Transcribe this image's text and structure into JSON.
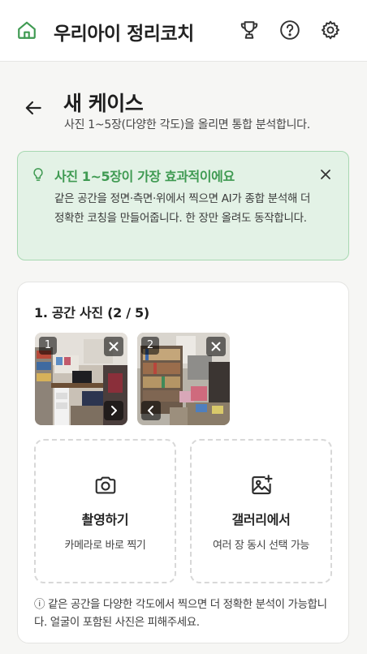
{
  "header": {
    "title": "우리아이 정리코치",
    "icons": [
      "home-icon",
      "trophy-icon",
      "help-icon",
      "gear-icon"
    ],
    "accent": "#3f9a52"
  },
  "page": {
    "title": "새 케이스",
    "subtitle": "사진 1~5장(다양한 각도)을 올리면 통합 분석합니다."
  },
  "tip": {
    "title": "사진 1~5장이 가장 효과적이에요",
    "body": "같은 공간을 정면·측면·위에서 찍으면 AI가 종합 분석해 더 정확한 코칭을 만들어줍니다. 한 장만 올려도 동작합니다.",
    "bg": "#e3f2e6",
    "border": "#a7d8b1"
  },
  "photos": {
    "section_title": "1. 공간 사진 (2 / 5)",
    "items": [
      {
        "index": "1",
        "nav": "next"
      },
      {
        "index": "2",
        "nav": "prev"
      }
    ]
  },
  "actions": {
    "camera": {
      "label": "촬영하기",
      "sub": "카메라로 바로 찍기"
    },
    "gallery": {
      "label": "갤러리에서",
      "sub": "여러 장 동시 선택 가능"
    }
  },
  "note": "ⓘ 같은 공간을 다양한 각도에서 찍으면 더 정확한 분석이 가능합니다. 얼굴이 포함된 사진은 피해주세요."
}
